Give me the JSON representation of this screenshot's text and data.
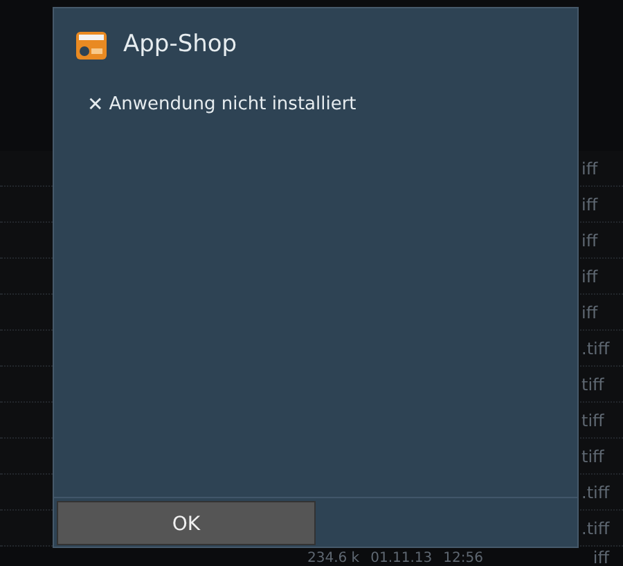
{
  "background_list": {
    "rows": [
      {
        "tail": "iff"
      },
      {
        "tail": "iff"
      },
      {
        "tail": "iff"
      },
      {
        "tail": "iff"
      },
      {
        "tail": "iff"
      },
      {
        "tail": ".tiff"
      },
      {
        "tail": "tiff"
      },
      {
        "tail": "tiff"
      },
      {
        "tail": "tiff"
      },
      {
        "tail": ".tiff"
      },
      {
        "tail": ".tiff"
      }
    ],
    "footer": {
      "size": "234.6 k",
      "date": "01.11.13",
      "time": "12:56",
      "tail": "iff"
    }
  },
  "dialog": {
    "title": "App-Shop",
    "message_icon": "✕",
    "message": "Anwendung nicht installiert",
    "buttons": [
      "OK"
    ]
  }
}
